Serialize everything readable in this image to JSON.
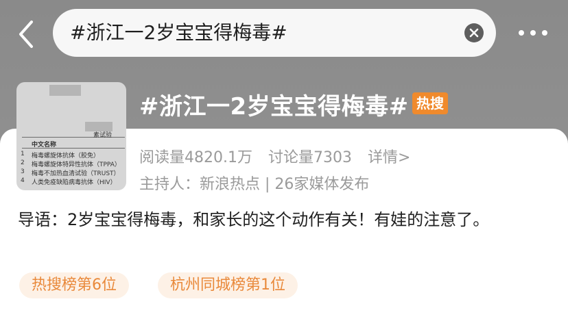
{
  "search": {
    "query": "#浙江一2岁宝宝得梅毒#"
  },
  "topic": {
    "title": "#浙江一2岁宝宝得梅毒#",
    "badge": "热搜",
    "reads": "阅读量4820.1万",
    "discussions": "讨论量7303",
    "details": "详情>",
    "host": "主持人：新浪热点 | 26家媒体发布",
    "intro": "导语：2岁宝宝得梅毒，和家长的这个动作有关！有娃的注意了。"
  },
  "tags": [
    {
      "label": "热搜榜第6位"
    },
    {
      "label": "杭州同城榜第1位"
    }
  ],
  "thumbnail": {
    "lines": [
      "素试验",
      "中文名称",
      "梅毒螺旋体抗体（胶免）",
      "梅毒螺旋体特异性抗体（TPPA）",
      "梅毒不加热血清试验（TRUST）",
      "人类免疫缺陷病毒抗体（HIV）"
    ],
    "numbers": [
      "1",
      "2",
      "3",
      "4"
    ]
  },
  "colors": {
    "background": "#8f8f8f",
    "badge": "#f08a2c",
    "tag_text": "#e9893a",
    "tag_bg": "#fdf1e6",
    "muted_text": "#9a9a9a"
  },
  "icons": {
    "back": "chevron-left-icon",
    "clear": "close-circle-icon",
    "more": "more-dots-icon"
  }
}
